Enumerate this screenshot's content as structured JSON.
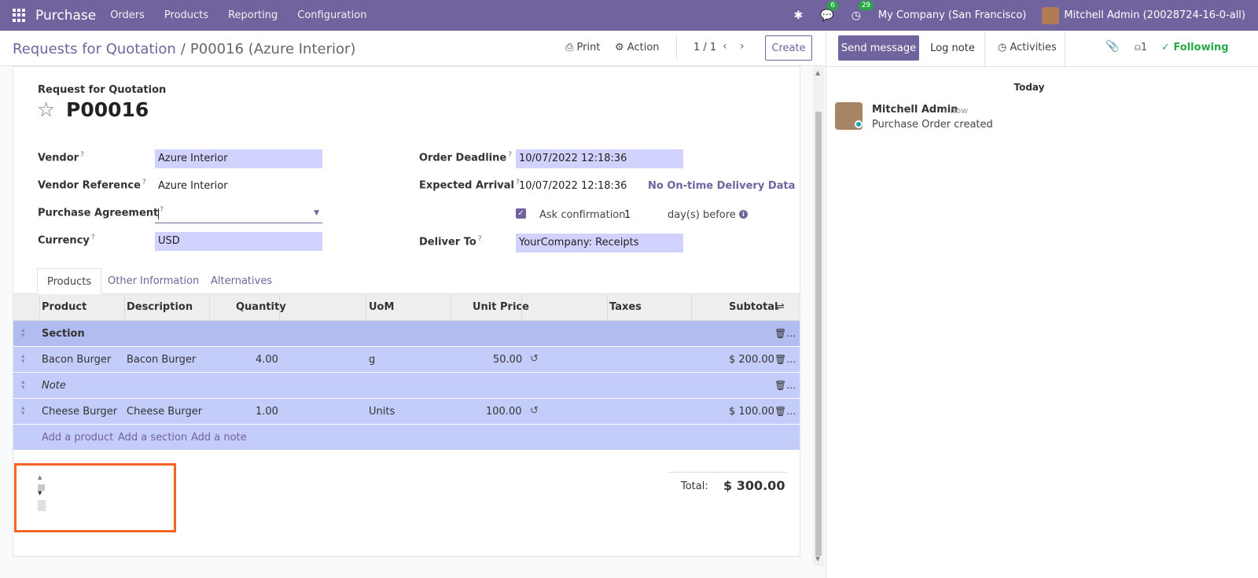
{
  "navbar": {
    "brand": "Purchase",
    "menu": [
      "Orders",
      "Products",
      "Reporting",
      "Configuration"
    ],
    "chat_count": "6",
    "activity_count": "29",
    "company": "My Company (San Francisco)",
    "user": "Mitchell Admin (20028724-16-0-all)"
  },
  "control": {
    "breadcrumb_parent": "Requests for Quotation",
    "breadcrumb_sep": "/",
    "breadcrumb_current": "P00016 (Azure Interior)",
    "print": "Print",
    "action": "Action",
    "pager": "1 / 1",
    "create": "Create"
  },
  "form": {
    "doc_type": "Request for Quotation",
    "name": "P00016",
    "vendor_label": "Vendor",
    "vendor": "Azure Interior",
    "vendor_ref_label": "Vendor Reference",
    "vendor_ref": "Azure Interior",
    "agreement_label": "Purchase Agreement",
    "currency_label": "Currency",
    "currency": "USD",
    "deadline_label": "Order Deadline",
    "deadline": "10/07/2022 12:18:36",
    "arrival_label": "Expected Arrival",
    "arrival": "10/07/2022 12:18:36",
    "ontime": "No On-time Delivery Data",
    "ask_confirmation": "Ask confirmation",
    "ask_days": "1",
    "days_before": "day(s) before",
    "deliver_label": "Deliver To",
    "deliver": "YourCompany: Receipts",
    "help_mark": "?"
  },
  "tabs": [
    "Products",
    "Other Information",
    "Alternatives"
  ],
  "table": {
    "headers": [
      "Product",
      "Description",
      "Quantity",
      "UoM",
      "Unit Price",
      "Taxes",
      "Subtotal"
    ],
    "section": "Section",
    "rows": [
      {
        "product": "Bacon Burger",
        "description": "Bacon Burger",
        "quantity": "4.00",
        "uom": "g",
        "price": "50.00",
        "subtotal": "$ 200.00"
      },
      {
        "product": "Cheese Burger",
        "description": "Cheese Burger",
        "quantity": "1.00",
        "uom": "Units",
        "price": "100.00",
        "subtotal": "$ 100.00"
      }
    ],
    "note": "Note",
    "add_product": "Add a product",
    "add_section": "Add a section",
    "add_note": "Add a note"
  },
  "totals": {
    "label": "Total:",
    "value": "$ 300.00"
  },
  "chatter": {
    "send": "Send message",
    "log": "Log note",
    "activities": "Activities",
    "followers": "1",
    "following": "Following",
    "today": "Today",
    "author": "Mitchell Admin",
    "time": "- now",
    "body": "Purchase Order created"
  },
  "colors": {
    "brand": "#71639e",
    "row_bg": "#c4cdfa",
    "required_bg": "#d2d2ff",
    "highlight": "#f26522",
    "following": "#28a745"
  }
}
